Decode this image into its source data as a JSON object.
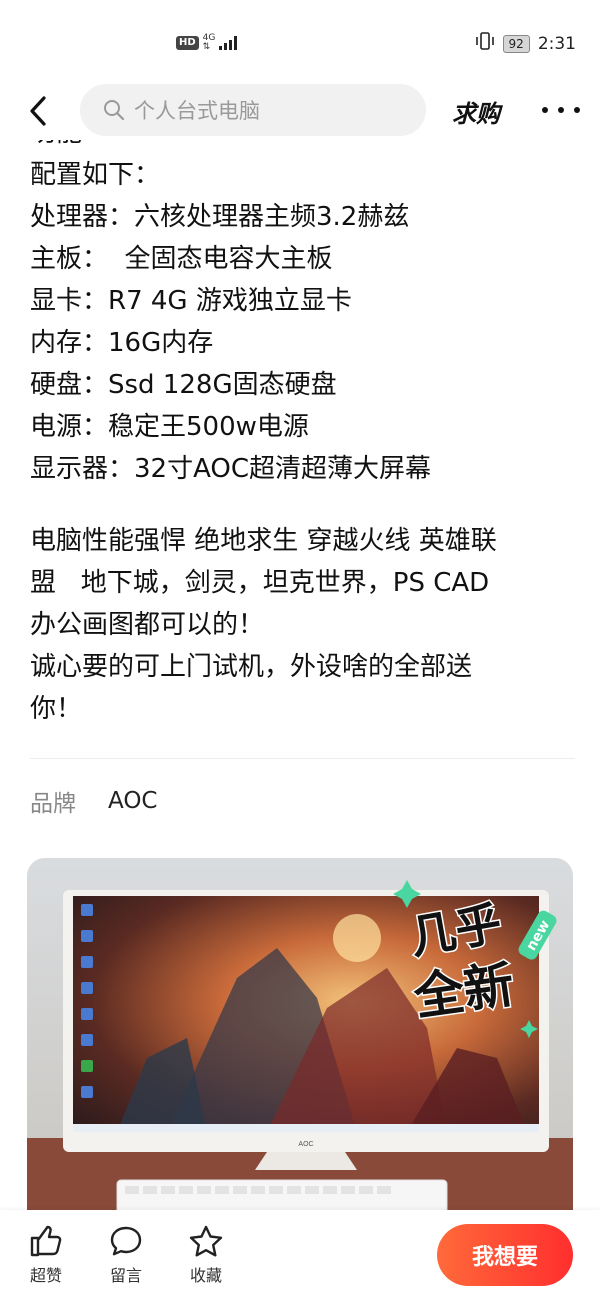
{
  "status_bar": {
    "hd": "HD",
    "network": "4G",
    "network_sub": "⇅",
    "battery": "92",
    "time": "2:31"
  },
  "header": {
    "search_placeholder": "个人台式电脑",
    "qiugou": "求购"
  },
  "description": {
    "cut_line": "功能",
    "config_lines": [
      "配置如下：",
      "处理器：六核处理器主频3.2赫兹",
      "主板：  全固态电容大主板",
      "显卡：R7 4G 游戏独立显卡",
      "内存：16G内存",
      "硬盘：Ssd 128G固态硬盘",
      "电源：稳定王500w电源",
      "显示器：32寸AOC超清超薄大屏幕"
    ],
    "para1_lines": [
      "电脑性能强悍 绝地求生 穿越火线 英雄联",
      "盟   地下城，剑灵，坦克世界，PS CAD",
      "办公画图都可以的！",
      "诚心要的可上门试机，外设啥的全部送",
      "你！"
    ]
  },
  "brand": {
    "label": "品牌",
    "value": "AOC"
  },
  "product_image": {
    "sticker_line1": "几乎",
    "sticker_line2": "全新",
    "sticker_tag": "new",
    "monitor_brand": "AOC"
  },
  "bottom_bar": {
    "like": "超赞",
    "comment": "留言",
    "favorite": "收藏",
    "want": "我想要"
  },
  "colors": {
    "accent": "#ff3d2e",
    "accent_start": "#ff6a3a",
    "muted": "#888888",
    "search_bg": "#f1f1f1"
  }
}
